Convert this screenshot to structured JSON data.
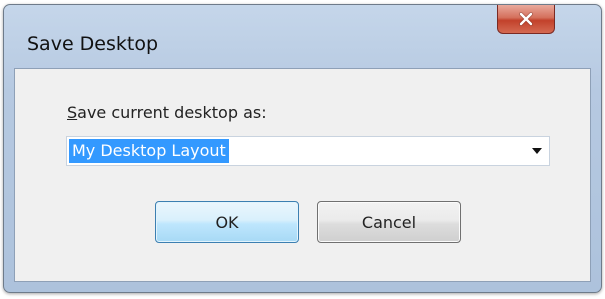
{
  "window": {
    "title": "Save Desktop"
  },
  "close_button": {
    "icon": "close-icon",
    "color": "#c7432c"
  },
  "form": {
    "label_accelerator": "S",
    "label_rest": "ave current desktop as:",
    "combo_value": "My Desktop Layout",
    "combo_selection_color": "#3399ff"
  },
  "buttons": {
    "ok_label": "OK",
    "cancel_label": "Cancel"
  }
}
